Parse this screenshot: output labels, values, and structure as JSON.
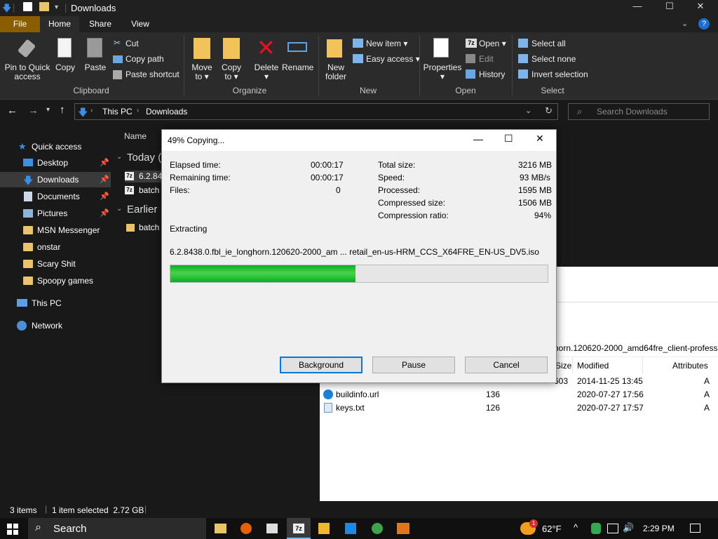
{
  "window": {
    "title": "Downloads",
    "controls": {
      "minimize": "—",
      "maximize": "☐",
      "close": "✕"
    }
  },
  "ribbon_tabs": [
    "File",
    "Home",
    "Share",
    "View"
  ],
  "ribbon": {
    "clipboard": {
      "group_label": "Clipboard",
      "pin_label_1": "Pin to Quick",
      "pin_label_2": "access",
      "copy": "Copy",
      "paste": "Paste",
      "cut": "Cut",
      "copy_path": "Copy path",
      "paste_shortcut": "Paste shortcut"
    },
    "organize": {
      "group_label": "Organize",
      "move_to_1": "Move",
      "move_to_2": "to ▾",
      "copy_to_1": "Copy",
      "copy_to_2": "to ▾",
      "delete_1": "Delete",
      "delete_2": "▾",
      "rename": "Rename"
    },
    "new": {
      "group_label": "New",
      "new_folder_1": "New",
      "new_folder_2": "folder",
      "new_item": "New item ▾",
      "easy_access": "Easy access ▾"
    },
    "open": {
      "group_label": "Open",
      "properties_1": "Properties",
      "properties_2": "▾",
      "open": "Open ▾",
      "edit": "Edit",
      "history": "History"
    },
    "select": {
      "group_label": "Select",
      "select_all": "Select all",
      "select_none": "Select none",
      "invert_selection": "Invert selection"
    }
  },
  "address": {
    "crumbs": [
      "This PC",
      "Downloads"
    ],
    "search_placeholder": "Search Downloads"
  },
  "nav": {
    "quick_access": "Quick access",
    "items": [
      {
        "label": "Desktop",
        "pinned": true
      },
      {
        "label": "Downloads",
        "pinned": true,
        "selected": true
      },
      {
        "label": "Documents",
        "pinned": true
      },
      {
        "label": "Pictures",
        "pinned": true
      },
      {
        "label": "MSN Messenger"
      },
      {
        "label": "onstar"
      },
      {
        "label": "Scary Shit"
      },
      {
        "label": "Spoopy games"
      }
    ],
    "this_pc": "This PC",
    "network": "Network"
  },
  "filelist": {
    "col_name": "Name",
    "group_today": "Today (",
    "group_earlier": "Earlier",
    "items": [
      "6.2.84",
      "batch",
      "batch"
    ]
  },
  "archive_window": {
    "path_fragment": "horn.120620-2000_amd64fre_client-professi",
    "columns": [
      "Size",
      "Modified",
      "Attributes"
    ],
    "rows": [
      {
        "name": "",
        "size": "603",
        "modified": "2014-11-25 13:45",
        "attr": "A"
      },
      {
        "name": "buildinfo.url",
        "size": "136",
        "modified": "2020-07-27 17:56",
        "attr": "A"
      },
      {
        "name": "keys.txt",
        "size": "126",
        "modified": "2020-07-27 17:57",
        "attr": "A"
      }
    ]
  },
  "dialog": {
    "title": "49% Copying...",
    "elapsed_label": "Elapsed time:",
    "elapsed_value": "00:00:17",
    "remaining_label": "Remaining time:",
    "remaining_value": "00:00:17",
    "files_label": "Files:",
    "files_value": "0",
    "total_label": "Total size:",
    "total_value": "3216 MB",
    "speed_label": "Speed:",
    "speed_value": "93 MB/s",
    "processed_label": "Processed:",
    "processed_value": "1595 MB",
    "compressed_label": "Compressed size:",
    "compressed_value": "1506 MB",
    "ratio_label": "Compression ratio:",
    "ratio_value": "94%",
    "operation": "Extracting",
    "current_file": "6.2.8438.0.fbl_ie_longhorn.120620-2000_am ... retail_en-us-HRM_CCS_X64FRE_EN-US_DV5.iso",
    "progress_fraction": 0.49,
    "btn_background": "Background",
    "btn_pause": "Pause",
    "btn_cancel": "Cancel"
  },
  "status": {
    "items_count": "3 items",
    "selection": "1 item selected  2.72 GB"
  },
  "taskbar": {
    "search": "Search",
    "weather": "62°F",
    "time": "2:29 PM",
    "weather_badge": "1"
  },
  "colors": {
    "accent_file_tab": "#8a5d00",
    "progress_green": "#06b025",
    "dark_bg": "#191919"
  }
}
